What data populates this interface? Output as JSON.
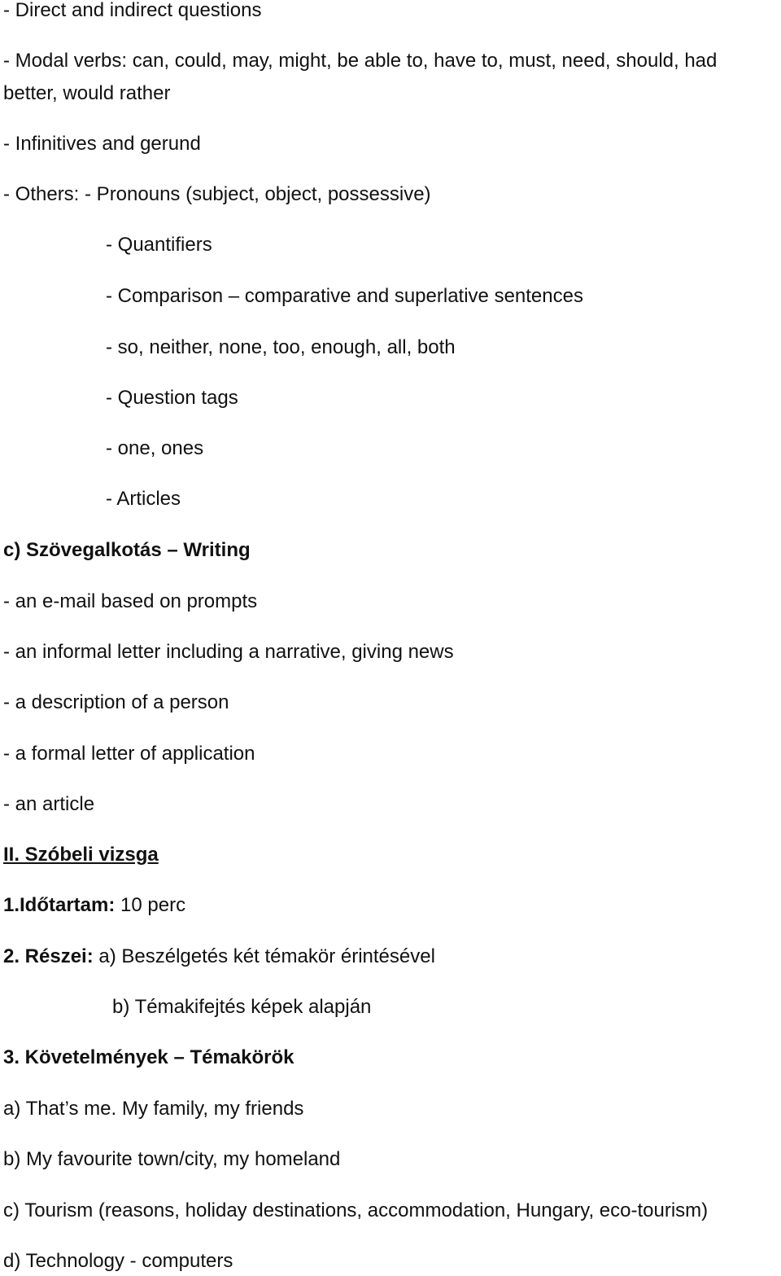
{
  "lines": {
    "l1": "- Direct and indirect questions",
    "l2": "- Modal verbs: can, could, may, might, be able to, have to, must, need, should, had",
    "l3": "better, would rather",
    "l4": "- Infinitives and gerund",
    "l5": "- Others: - Pronouns (subject, object, possessive)",
    "l6": "- Quantifiers",
    "l7": "- Comparison – comparative and superlative sentences",
    "l8": "- so, neither, none, too, enough, all, both",
    "l9": "- Question tags",
    "l10": "- one, ones",
    "l11": "- Articles",
    "l12": "c) Szövegalkotás – Writing",
    "l13": "- an e-mail based on prompts",
    "l14": "- an informal letter including a narrative, giving news",
    "l15": "- a description of a person",
    "l16": "- a formal letter of application",
    "l17": "- an article",
    "l18": "II. Szóbeli vizsga",
    "l19_label": "1.Időtartam:",
    "l19_value": " 10 perc",
    "l20_label": "2. Részei:",
    "l20_value": " a) Beszélgetés két témakör érintésével",
    "l21": "b) Témakifejtés képek alapján",
    "l22": "3. Követelmények – Témakörök",
    "l23": "a) That’s me. My family, my friends",
    "l24": "b) My favourite town/city, my homeland",
    "l25": "c) Tourism (reasons, holiday destinations, accommodation, Hungary, eco-tourism)",
    "l26": "d) Technology - computers"
  }
}
